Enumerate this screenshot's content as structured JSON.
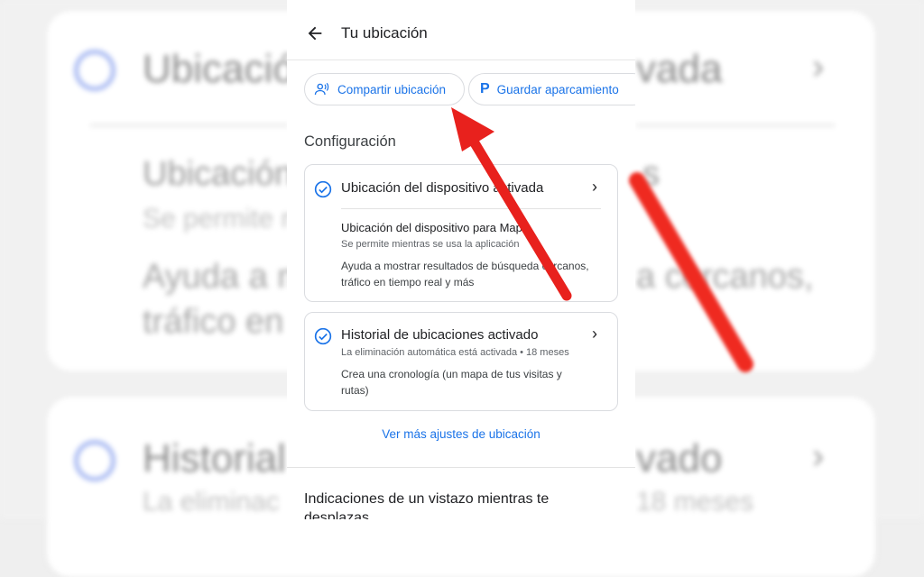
{
  "background": {
    "card1_title_left": "Ubicació",
    "card1_title_right": "vada",
    "row_title": "Ubicación",
    "row_title_right": "s",
    "row_sub": "Se permite m",
    "row_desc1_left": "Ayuda a mo",
    "row_desc1_right": "a cercanos,",
    "row_desc2": "tráfico en tie",
    "card2_title_left": "Historial",
    "card2_title_right": "vado",
    "card2_sub_left": "La eliminac",
    "card2_sub_right": "18 meses"
  },
  "header": {
    "title": "Tu ubicación"
  },
  "chips": {
    "share_label": "Compartir ubicación",
    "park_icon": "P",
    "park_label": "Guardar aparcamiento"
  },
  "config": {
    "section_title": "Configuración",
    "device_location": {
      "title": "Ubicación del dispositivo activada",
      "sub_title": "Ubicación del dispositivo para Maps",
      "sub_status": "Se permite mientras se usa la aplicación",
      "description": "Ayuda a mostrar resultados de búsqueda cercanos, tráfico en tiempo real y más"
    },
    "history": {
      "title": "Historial de ubicaciones activado",
      "status": "La eliminación automática está activada • 18 meses",
      "description": "Crea una cronología (un mapa de tus visitas y rutas)"
    }
  },
  "more_settings_link": "Ver más ajustes de ubicación",
  "bottom_section": {
    "title": "Indicaciones de un vistazo mientras te desplazas"
  },
  "colors": {
    "accent": "#1a73e8",
    "arrow": "#e8211d"
  },
  "icons": {
    "back": "arrow-left",
    "share": "people-share",
    "check": "check-circle",
    "chevron": "chevron-right"
  }
}
